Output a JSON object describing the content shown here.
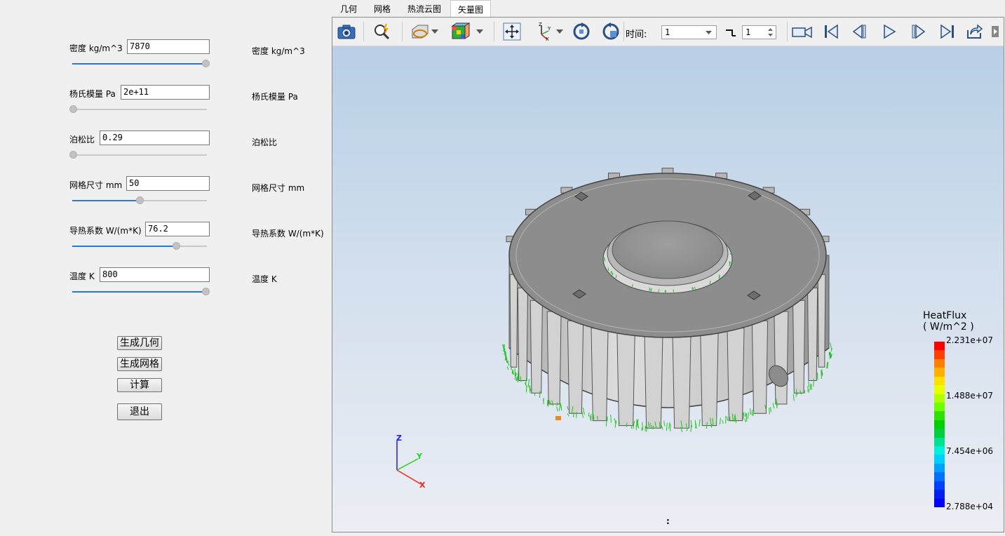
{
  "params": [
    {
      "label": "密度 kg/m^3",
      "value": "7870",
      "right": "密度 kg/m^3",
      "slider": 1.0
    },
    {
      "label": "杨氏模量 Pa",
      "value": "2e+11",
      "right": "杨氏模量 Pa",
      "slider": 0.0
    },
    {
      "label": "泊松比",
      "value": "0.29",
      "right": "泊松比",
      "slider": 0.0
    },
    {
      "label": "网格尺寸 mm",
      "value": "50",
      "right": "网格尺寸 mm",
      "slider": 0.5
    },
    {
      "label": "导热系数 W/(m*K)",
      "value": "76.2",
      "right": "导热系数 W/(m*K)",
      "slider": 0.78
    },
    {
      "label": "温度 K",
      "value": "800",
      "right": "温度 K",
      "slider": 1.0
    }
  ],
  "buttons": {
    "gen_geom": "生成几何",
    "gen_mesh": "生成网格",
    "compute": "计算",
    "exit": "退出"
  },
  "tabs": [
    "几何",
    "网格",
    "热流云图",
    "矢量图"
  ],
  "active_tab": 3,
  "toolbar": {
    "time_label": "时间:",
    "time_value": "1",
    "step_value": "1"
  },
  "legend": {
    "title": "HeatFlux",
    "unit": "( W/m^2 )",
    "ticks": [
      "2.231e+07",
      "1.488e+07",
      "7.454e+06",
      "2.788e+04"
    ]
  },
  "axes": {
    "z": "Z",
    "y": "Y",
    "x": "X"
  },
  "status_text": ":",
  "colors": {
    "accent": "#2a78d6",
    "legend_top": "#ff0000",
    "legend_bottom": "#0000ff"
  }
}
